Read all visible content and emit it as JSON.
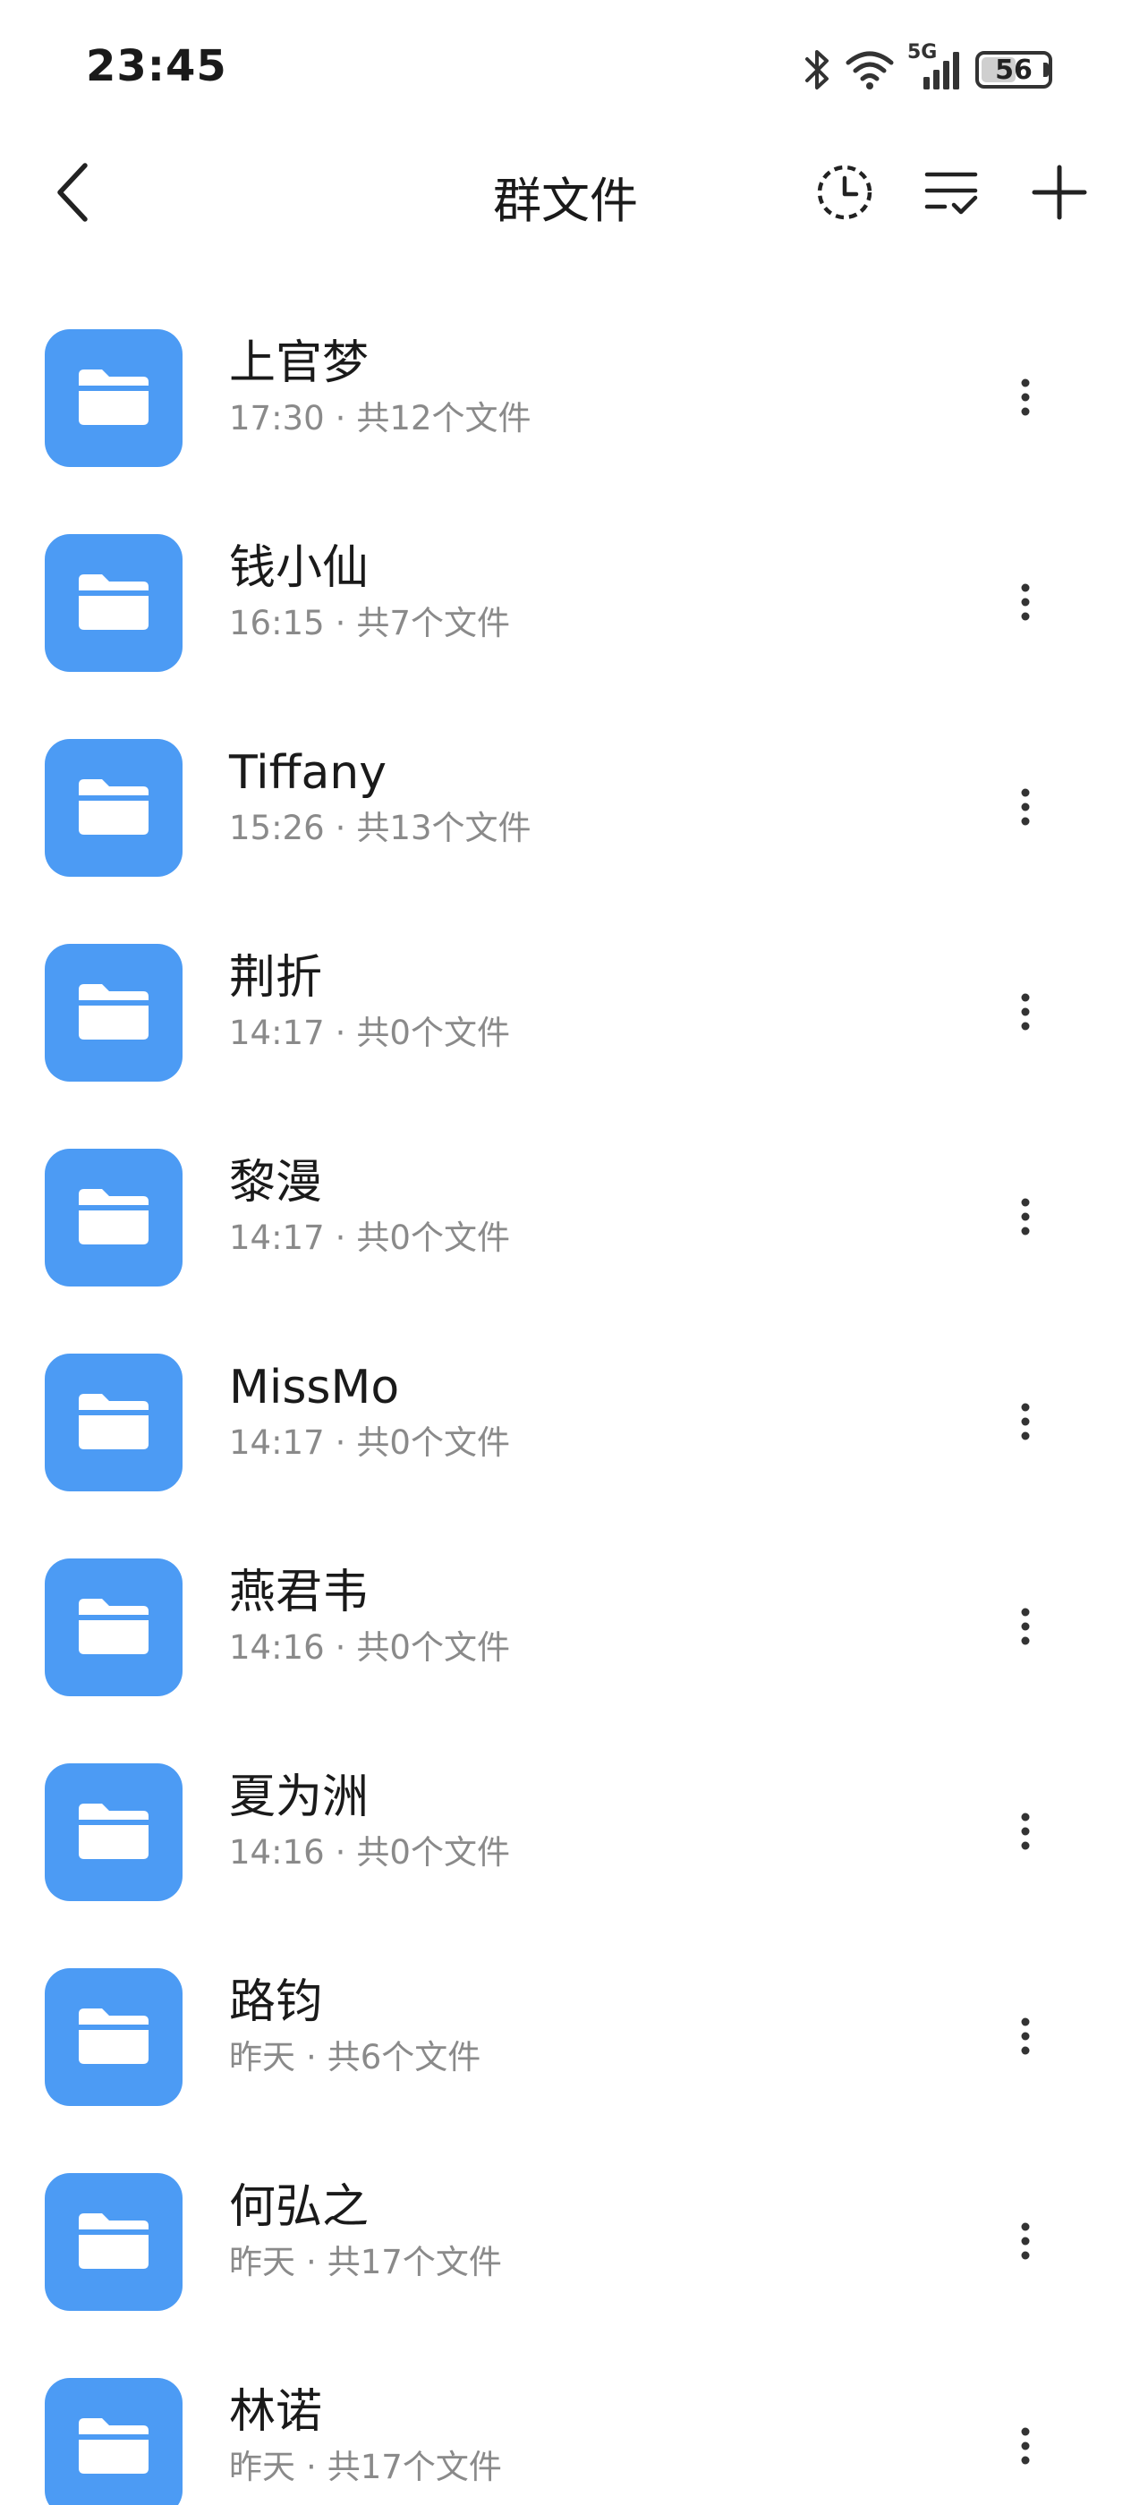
{
  "status_bar": {
    "time": "23:45",
    "network_label": "5G",
    "battery_percent": 56,
    "battery_label": "56",
    "icons": [
      "bluetooth-icon",
      "wifi-icon",
      "signal-icon",
      "battery-icon"
    ]
  },
  "header": {
    "title": "群文件",
    "back_icon": "chevron-left-icon",
    "actions": [
      "clock-icon",
      "sort-list-icon",
      "plus-icon"
    ]
  },
  "colors": {
    "folder_blue": "#4c9bf4",
    "text_primary": "#1a1a1a",
    "text_secondary": "#8a8a8a",
    "background": "#ffffff"
  },
  "meta_separator": "·",
  "folders": [
    {
      "name": "上官梦",
      "time": "17:30",
      "count": "共12个文件"
    },
    {
      "name": "钱小仙",
      "time": "16:15",
      "count": "共7个文件"
    },
    {
      "name": "Tiffany",
      "time": "15:26",
      "count": "共13个文件"
    },
    {
      "name": "荆折",
      "time": "14:17",
      "count": "共0个文件"
    },
    {
      "name": "黎漫",
      "time": "14:17",
      "count": "共0个文件"
    },
    {
      "name": "MissMo",
      "time": "14:17",
      "count": "共0个文件"
    },
    {
      "name": "燕君韦",
      "time": "14:16",
      "count": "共0个文件"
    },
    {
      "name": "夏为洲",
      "time": "14:16",
      "count": "共0个文件"
    },
    {
      "name": "路钧",
      "time": "昨天",
      "count": "共6个文件"
    },
    {
      "name": "何弘之",
      "time": "昨天",
      "count": "共17个文件"
    },
    {
      "name": "林诺",
      "time": "昨天",
      "count": "共17个文件"
    }
  ]
}
